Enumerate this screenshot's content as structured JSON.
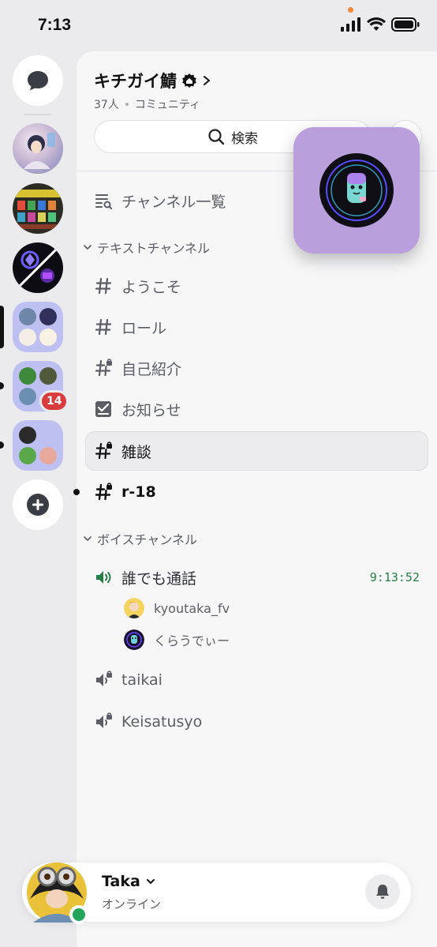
{
  "status_bar": {
    "time": "7:13"
  },
  "guild": {
    "name": "キチガイ鯖",
    "member_count": "37人",
    "type": "コミュニティ",
    "search_label": "検索"
  },
  "channels": {
    "browse_label": "チャンネル一覧",
    "text_category": "テキストチャンネル",
    "text": [
      {
        "name": "ようこそ",
        "icon": "hash-icon"
      },
      {
        "name": "ロール",
        "icon": "hash-icon"
      },
      {
        "name": "自己紹介",
        "icon": "hash-locked-icon"
      },
      {
        "name": "お知らせ",
        "icon": "announcement-icon"
      },
      {
        "name": "雑談",
        "icon": "hash-locked-icon",
        "selected": true
      },
      {
        "name": "r-18",
        "icon": "hash-locked-icon",
        "unread": true
      }
    ],
    "voice_category": "ボイスチャンネル",
    "voice": [
      {
        "name": "誰でも通話",
        "timer": "9:13:52",
        "active": true
      },
      {
        "name": "taikai"
      },
      {
        "name": "Keisatusyo"
      }
    ],
    "voice_users": [
      {
        "name": "kyoutaka_fv"
      },
      {
        "name": "くらうでぃー"
      }
    ]
  },
  "server_rail": {
    "badge_count": "14"
  },
  "user": {
    "name": "Taka",
    "status": "オンライン"
  },
  "colors": {
    "accent_green": "#248046",
    "online_green": "#23a55a",
    "badge_red": "#d83c3e",
    "folder_purple": "#bfc0f2"
  }
}
